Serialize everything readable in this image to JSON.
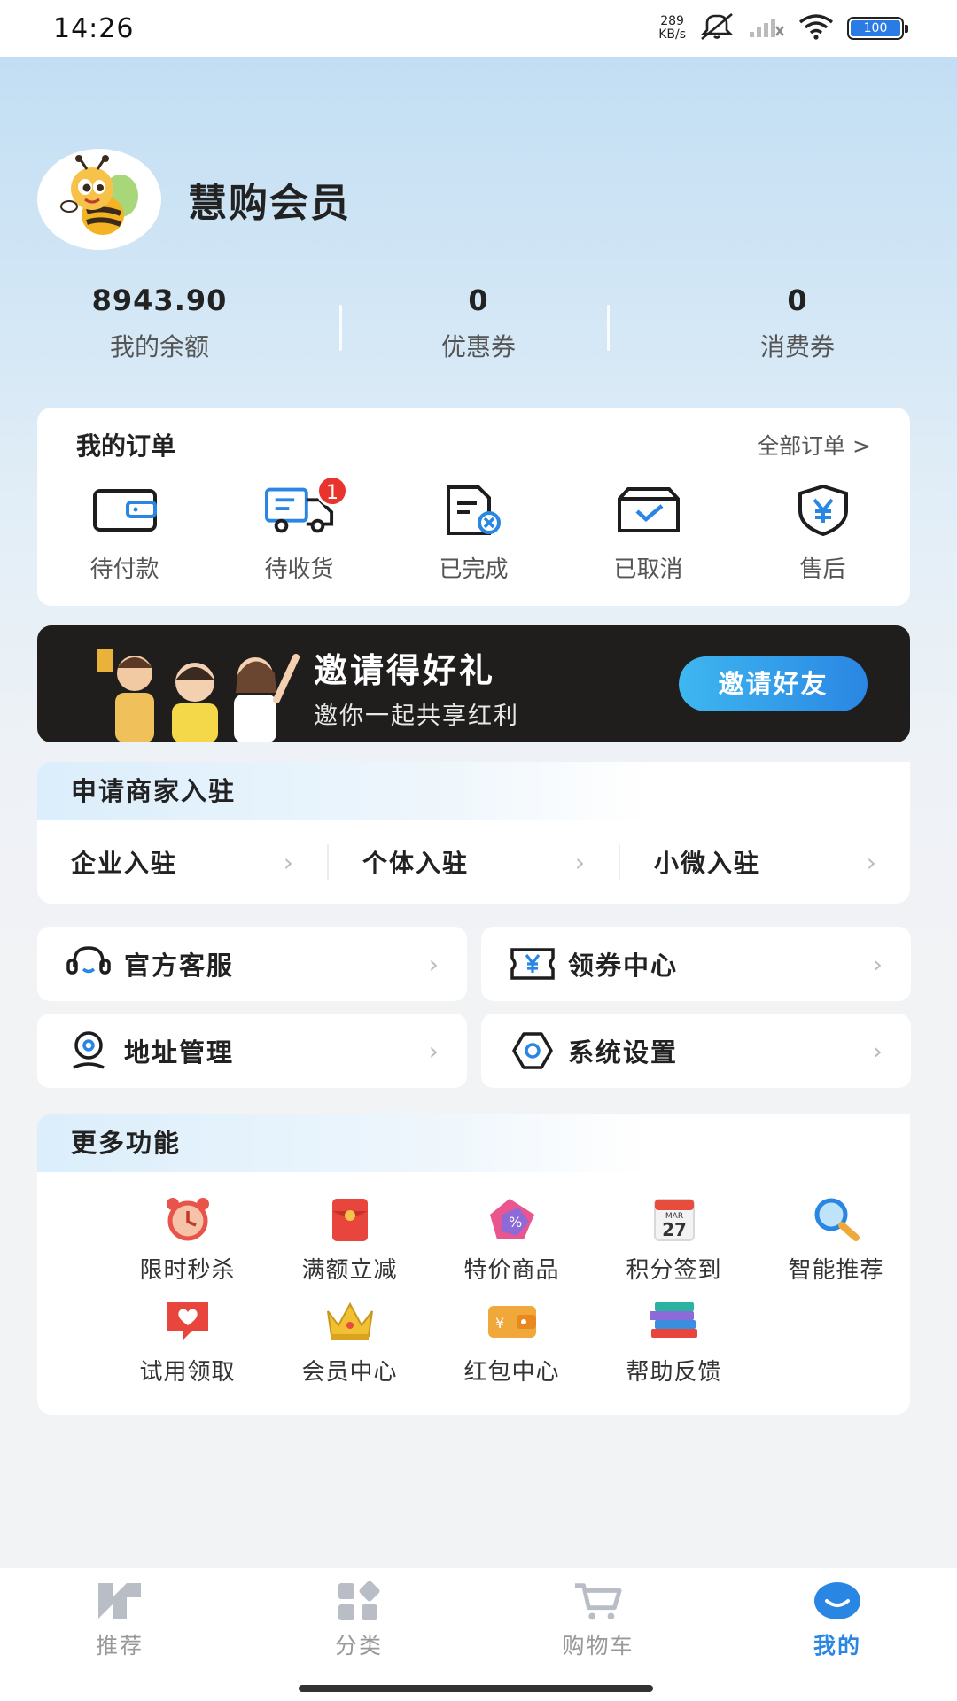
{
  "status_bar": {
    "time": "14:26",
    "net_speed_value": "289",
    "net_speed_unit": "KB/s",
    "battery": "100"
  },
  "profile": {
    "name": "慧购会员"
  },
  "stats": [
    {
      "value": "8943.90",
      "label": "我的余额"
    },
    {
      "value": "0",
      "label": "优惠券"
    },
    {
      "value": "0",
      "label": "消费券"
    }
  ],
  "orders": {
    "title": "我的订单",
    "all_label": "全部订单 >",
    "items": [
      {
        "label": "待付款",
        "icon": "wallet-icon"
      },
      {
        "label": "待收货",
        "icon": "truck-icon",
        "badge": "1"
      },
      {
        "label": "已完成",
        "icon": "document-done-icon"
      },
      {
        "label": "已取消",
        "icon": "box-icon"
      },
      {
        "label": "售后",
        "icon": "shield-yen-icon"
      }
    ]
  },
  "invite": {
    "title": "邀请得好礼",
    "subtitle": "邀你一起共享红利",
    "button": "邀请好友"
  },
  "merchant": {
    "title": "申请商家入驻",
    "options": [
      "企业入驻",
      "个体入驻",
      "小微入驻"
    ]
  },
  "tiles": [
    {
      "label": "官方客服",
      "icon": "headset-icon"
    },
    {
      "label": "领券中心",
      "icon": "coupon-icon"
    },
    {
      "label": "地址管理",
      "icon": "location-icon"
    },
    {
      "label": "系统设置",
      "icon": "gear-icon"
    }
  ],
  "more": {
    "title": "更多功能",
    "items": [
      {
        "label": "限时秒杀",
        "icon": "alarm-clock-icon"
      },
      {
        "label": "满额立减",
        "icon": "red-envelope-icon"
      },
      {
        "label": "特价商品",
        "icon": "discount-bag-icon"
      },
      {
        "label": "积分签到",
        "icon": "calendar-icon",
        "calendar_month": "MAR",
        "calendar_day": "27"
      },
      {
        "label": "智能推荐",
        "icon": "magnifier-icon"
      },
      {
        "label": "试用领取",
        "icon": "heart-message-icon"
      },
      {
        "label": "会员中心",
        "icon": "crown-icon"
      },
      {
        "label": "红包中心",
        "icon": "wallet-yen-icon"
      },
      {
        "label": "帮助反馈",
        "icon": "books-icon"
      }
    ]
  },
  "tabbar": {
    "tabs": [
      {
        "label": "推荐",
        "icon": "recommend-icon"
      },
      {
        "label": "分类",
        "icon": "category-icon"
      },
      {
        "label": "购物车",
        "icon": "cart-icon"
      },
      {
        "label": "我的",
        "icon": "profile-icon"
      }
    ],
    "active_index": 3,
    "active_color": "#2a86e3"
  },
  "colors": {
    "accent": "#2a86e3",
    "badge": "#e8342c",
    "invite_bg": "#1f1e1d"
  }
}
